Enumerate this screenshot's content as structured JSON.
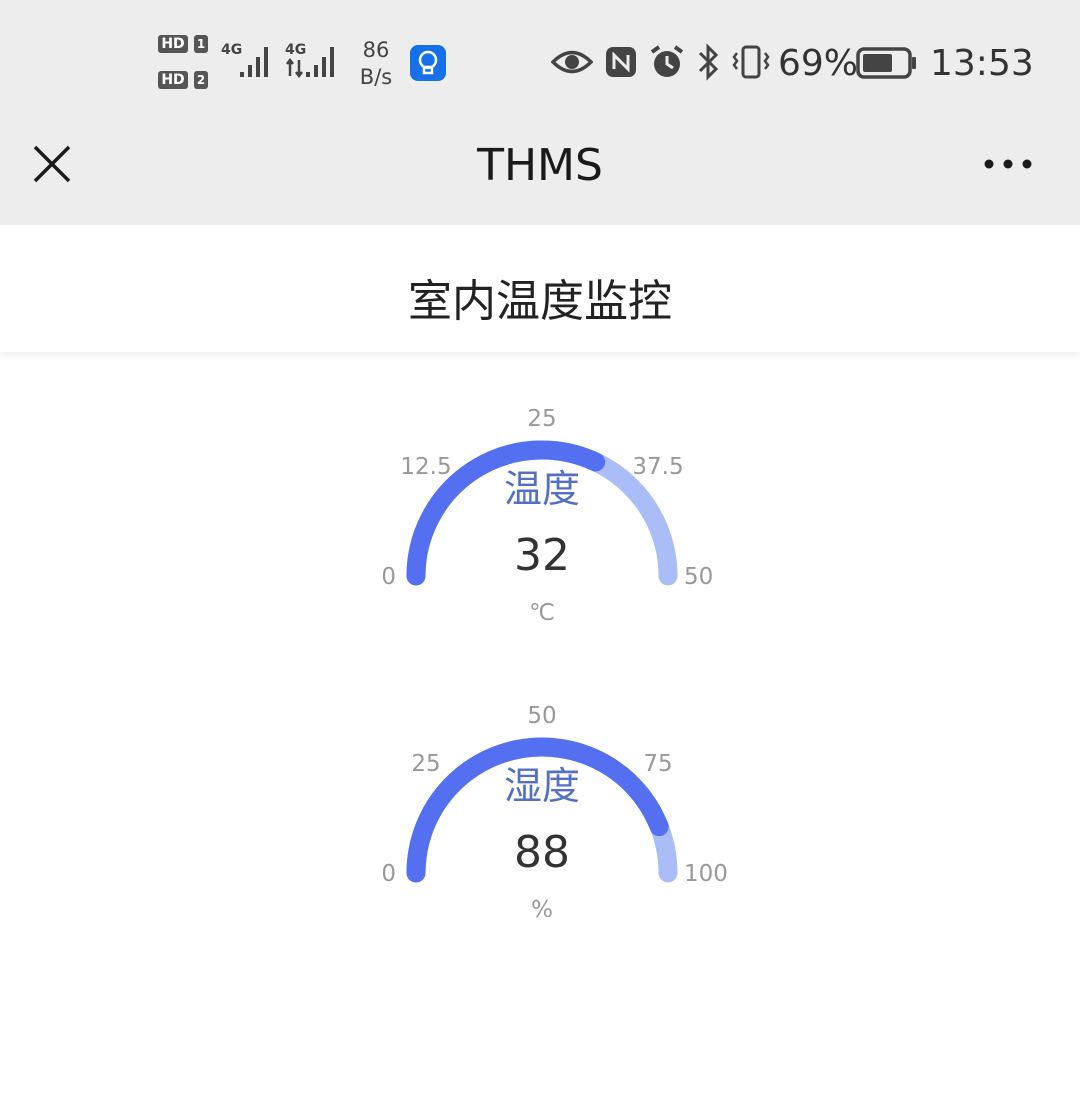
{
  "status_bar": {
    "sim1_badge": "HD",
    "sim1_index": "1",
    "sim2_badge": "HD",
    "sim2_index": "2",
    "net1": "4G",
    "net2": "4G",
    "speed_value": "86",
    "speed_unit": "B/s",
    "battery_percent": "69%",
    "battery_level": 0.69,
    "time": "13:53",
    "icons": [
      "bulb-app-icon",
      "eye-icon",
      "nfc-icon",
      "alarm-icon",
      "bluetooth-icon",
      "vibrate-icon",
      "battery-icon"
    ]
  },
  "nav": {
    "title": "THMS",
    "close_icon": "close-icon",
    "more_icon": "more-icon"
  },
  "page": {
    "title": "室内温度监控"
  },
  "chart_data": [
    {
      "type": "gauge",
      "title": "温度",
      "value": 32,
      "unit": "℃",
      "min": 0,
      "max": 50,
      "ticks": [
        "0",
        "12.5",
        "25",
        "37.5",
        "50"
      ],
      "colors": {
        "progress": "#5470f0",
        "track": "#aabdf6",
        "title": "#5470c6",
        "value": "#333333"
      }
    },
    {
      "type": "gauge",
      "title": "湿度",
      "value": 88,
      "unit": "%",
      "min": 0,
      "max": 100,
      "ticks": [
        "0",
        "25",
        "50",
        "75",
        "100"
      ],
      "colors": {
        "progress": "#5470f0",
        "track": "#aabdf6",
        "title": "#5470c6",
        "value": "#333333"
      }
    }
  ]
}
